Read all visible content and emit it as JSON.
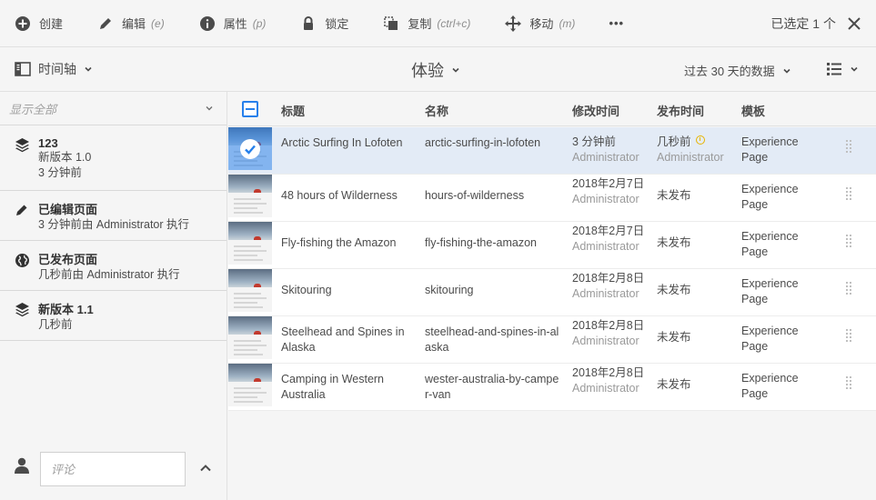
{
  "actionbar": {
    "actions": [
      {
        "label": "创建",
        "shortcut": ""
      },
      {
        "label": "编辑",
        "shortcut": "(e)"
      },
      {
        "label": "属性",
        "shortcut": "(p)"
      },
      {
        "label": "锁定",
        "shortcut": ""
      },
      {
        "label": "复制",
        "shortcut": "(ctrl+c)"
      },
      {
        "label": "移动",
        "shortcut": "(m)"
      }
    ],
    "more_label": "•••",
    "selection_text": "已选定 1 个"
  },
  "subbar": {
    "rail_label": "时间轴",
    "page_title": "体验",
    "date_filter": "过去 30 天的数据"
  },
  "rail": {
    "filter_label": "显示全部",
    "items": [
      {
        "title": "123",
        "line1": "新版本 1.0",
        "line2": "3 分钟前"
      },
      {
        "title": "已编辑页面",
        "line1": "3 分钟前由 Administrator 执行",
        "line2": ""
      },
      {
        "title": "已发布页面",
        "line1": "几秒前由 Administrator 执行",
        "line2": ""
      },
      {
        "title": "新版本 1.1",
        "line1": "几秒前",
        "line2": ""
      }
    ],
    "comment_placeholder": "评论"
  },
  "table": {
    "columns": [
      "标题",
      "名称",
      "修改时间",
      "发布时间",
      "模板"
    ],
    "rows": [
      {
        "title": "Arctic Surfing In Lofoten",
        "name": "arctic-surfing-in-lofoten",
        "modified": "3 分钟前",
        "modified_by": "Administrator",
        "published": "几秒前",
        "published_by": "Administrator",
        "template": "Experience Page",
        "selected": true
      },
      {
        "title": "48 hours of Wilderness",
        "name": "hours-of-wilderness",
        "modified": "2018年2月7日",
        "modified_by": "Administrator",
        "published": "未发布",
        "published_by": "",
        "template": "Experience Page",
        "selected": false
      },
      {
        "title": "Fly-fishing the Amazon",
        "name": "fly-fishing-the-amazon",
        "modified": "2018年2月7日",
        "modified_by": "Administrator",
        "published": "未发布",
        "published_by": "",
        "template": "Experience Page",
        "selected": false
      },
      {
        "title": "Skitouring",
        "name": "skitouring",
        "modified": "2018年2月8日",
        "modified_by": "Administrator",
        "published": "未发布",
        "published_by": "",
        "template": "Experience Page",
        "selected": false
      },
      {
        "title": "Steelhead and Spines in Alaska",
        "name": "steelhead-and-spines-in-alaska",
        "modified": "2018年2月8日",
        "modified_by": "Administrator",
        "published": "未发布",
        "published_by": "",
        "template": "Experience Page",
        "selected": false
      },
      {
        "title": "Camping in Western Australia",
        "name": "wester-australia-by-camper-van",
        "modified": "2018年2月8日",
        "modified_by": "Administrator",
        "published": "未发布",
        "published_by": "",
        "template": "Experience Page",
        "selected": false
      }
    ]
  },
  "colors": {
    "accent": "#2680eb",
    "selected_row": "#e3ebf6",
    "background": "#f5f5f5",
    "warning": "#e8b400"
  }
}
